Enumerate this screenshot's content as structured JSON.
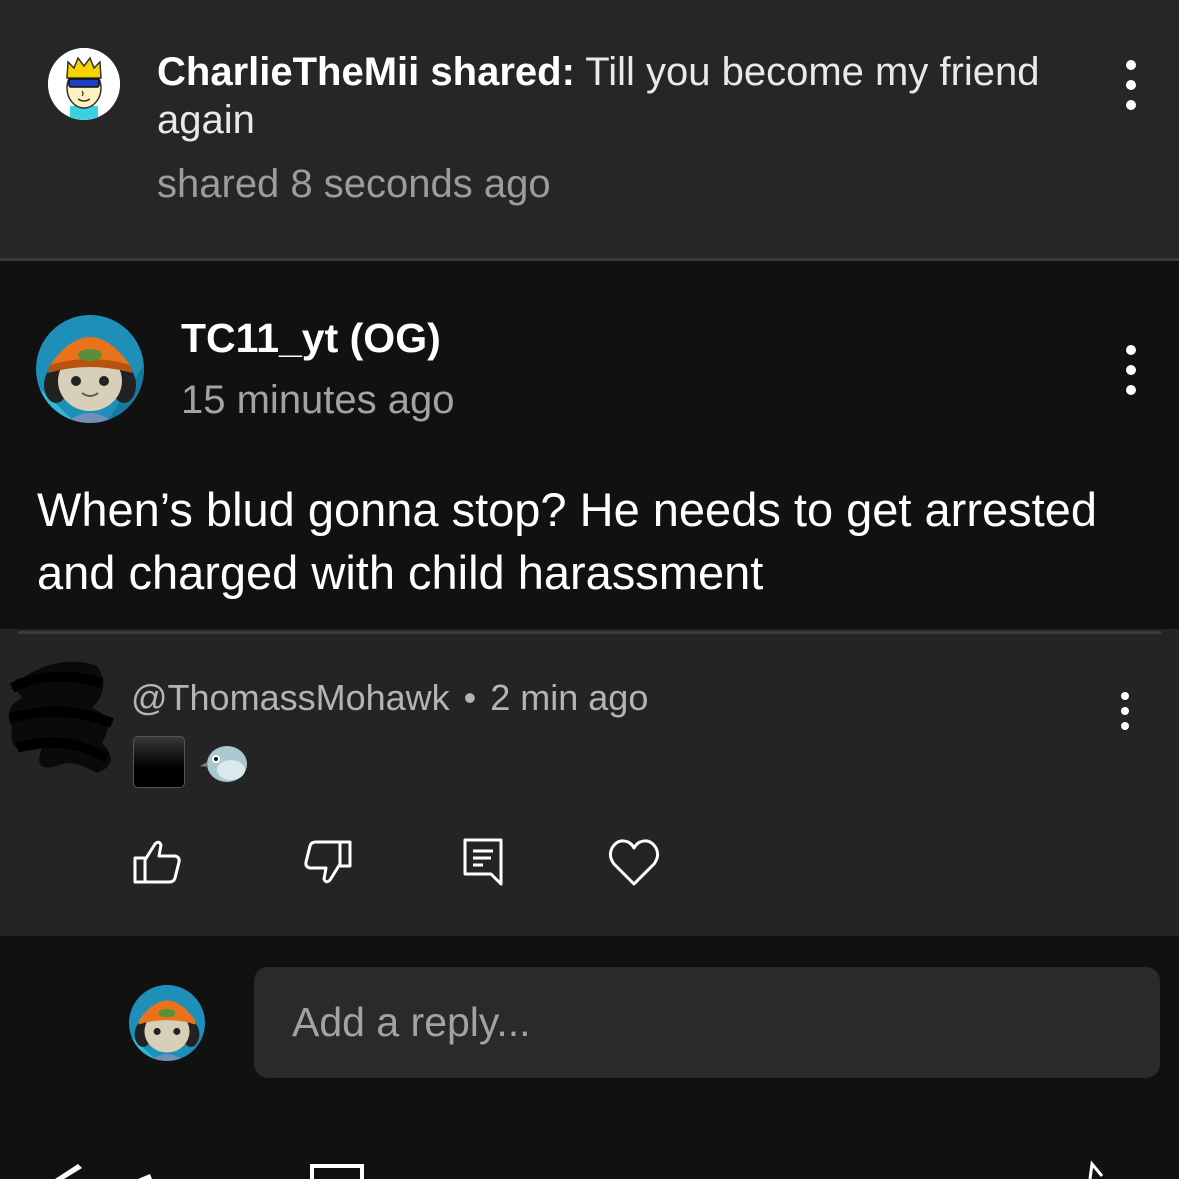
{
  "shared_notice": {
    "username": "CharlieTheMii",
    "action": "shared:",
    "title": "Till you become my friend again",
    "time": "shared 8 seconds ago"
  },
  "post": {
    "username": "TC11_yt (OG)",
    "time": "15 minutes ago",
    "body": "When’s blud gonna stop? He needs to get arrested and charged with child harassment"
  },
  "reply": {
    "handle": "@ThomassMohawk",
    "separator": "•",
    "time": "2 min ago",
    "emojis": [
      "black-square",
      "bird"
    ]
  },
  "actions": [
    {
      "name": "like",
      "icon": "thumbs-up-icon"
    },
    {
      "name": "dislike",
      "icon": "thumbs-down-icon"
    },
    {
      "name": "reply",
      "icon": "comment-icon"
    },
    {
      "name": "heart",
      "icon": "heart-icon"
    }
  ],
  "reply_box": {
    "placeholder": "Add a reply..."
  },
  "colors": {
    "background": "#111111",
    "shared_card": "#262626",
    "reply_card": "#242424",
    "input_bg": "#2a2a2a",
    "secondary_text": "#a3a3a3"
  }
}
